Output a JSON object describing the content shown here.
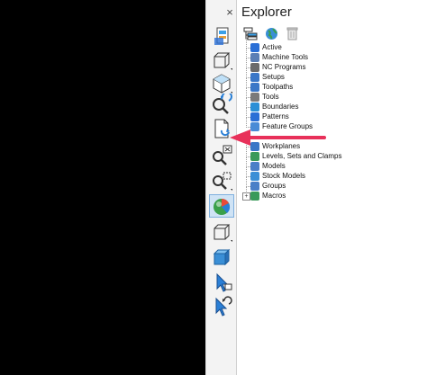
{
  "panel": {
    "title": "Explorer",
    "close_glyph": "×"
  },
  "panel_toolbar": [
    {
      "name": "explorer-tree-icon"
    },
    {
      "name": "globe-icon"
    },
    {
      "name": "trash-icon"
    }
  ],
  "tree": [
    {
      "label": "Active",
      "icon": "active-icon",
      "color": "#2a6fd6"
    },
    {
      "label": "Machine Tools",
      "icon": "machine-tools-icon",
      "color": "#5b7fb5"
    },
    {
      "label": "NC Programs",
      "icon": "nc-programs-icon",
      "color": "#6b6b6b"
    },
    {
      "label": "Setups",
      "icon": "setups-icon",
      "color": "#3a77c7"
    },
    {
      "label": "Toolpaths",
      "icon": "toolpaths-icon",
      "color": "#3a77c7"
    },
    {
      "label": "Tools",
      "icon": "tools-icon",
      "color": "#7a7a7a"
    },
    {
      "label": "Boundaries",
      "icon": "boundaries-icon",
      "color": "#2a8fd6"
    },
    {
      "label": "Patterns",
      "icon": "patterns-icon",
      "color": "#2a6fd6"
    },
    {
      "label": "Feature Groups",
      "icon": "feature-groups-icon",
      "color": "#4a8bd6"
    },
    {
      "label": "Workplanes",
      "icon": "workplanes-icon",
      "color": "#3a77c7"
    },
    {
      "label": "Levels, Sets and Clamps",
      "icon": "levels-sets-clamps-icon",
      "color": "#3a9a5a"
    },
    {
      "label": "Models",
      "icon": "models-icon",
      "color": "#4a7fc7"
    },
    {
      "label": "Stock Models",
      "icon": "stock-models-icon",
      "color": "#3a8fd6"
    },
    {
      "label": "Groups",
      "icon": "groups-icon",
      "color": "#4a7fc7"
    },
    {
      "label": "Macros",
      "icon": "macros-icon",
      "color": "#3a9a5a",
      "expander": "+"
    }
  ],
  "toolbar": [
    {
      "name": "toolbar-view-icon"
    },
    {
      "name": "wireframe-box-icon"
    },
    {
      "name": "iso-cube-icon"
    },
    {
      "name": "zoom-undo-icon"
    },
    {
      "name": "refresh-document-icon"
    },
    {
      "name": "zoom-fit-icon"
    },
    {
      "name": "zoom-box-icon"
    },
    {
      "name": "shaded-sphere-icon"
    },
    {
      "name": "wireframe-cube-icon"
    },
    {
      "name": "shaded-cube-icon"
    },
    {
      "name": "select-cursor-icon"
    },
    {
      "name": "select-undo-icon"
    }
  ],
  "colors": {
    "viewport": "#000000",
    "annotation_arrow": "#e8315a"
  }
}
